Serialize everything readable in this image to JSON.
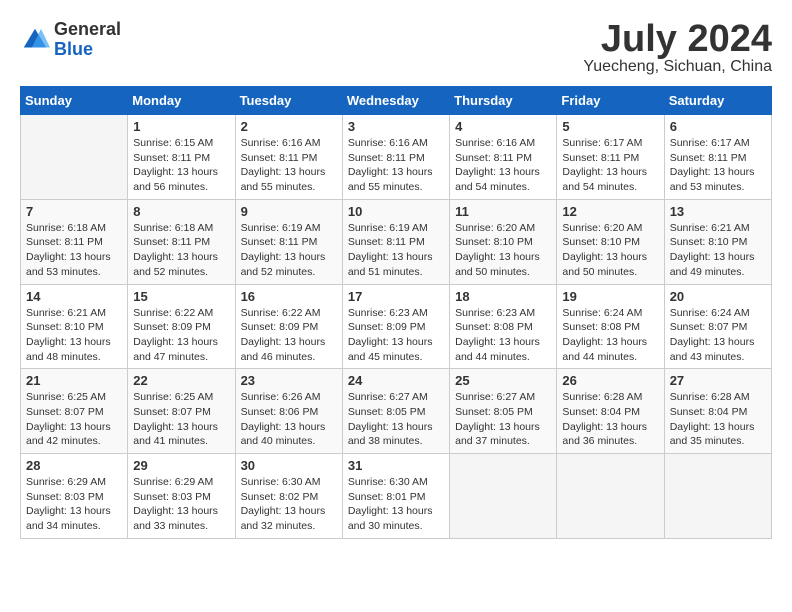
{
  "header": {
    "logo_general": "General",
    "logo_blue": "Blue",
    "month_year": "July 2024",
    "location": "Yuecheng, Sichuan, China"
  },
  "days_of_week": [
    "Sunday",
    "Monday",
    "Tuesday",
    "Wednesday",
    "Thursday",
    "Friday",
    "Saturday"
  ],
  "weeks": [
    [
      {
        "day": "",
        "empty": true
      },
      {
        "day": "1",
        "sunrise": "6:15 AM",
        "sunset": "8:11 PM",
        "daylight": "13 hours and 56 minutes."
      },
      {
        "day": "2",
        "sunrise": "6:16 AM",
        "sunset": "8:11 PM",
        "daylight": "13 hours and 55 minutes."
      },
      {
        "day": "3",
        "sunrise": "6:16 AM",
        "sunset": "8:11 PM",
        "daylight": "13 hours and 55 minutes."
      },
      {
        "day": "4",
        "sunrise": "6:16 AM",
        "sunset": "8:11 PM",
        "daylight": "13 hours and 54 minutes."
      },
      {
        "day": "5",
        "sunrise": "6:17 AM",
        "sunset": "8:11 PM",
        "daylight": "13 hours and 54 minutes."
      },
      {
        "day": "6",
        "sunrise": "6:17 AM",
        "sunset": "8:11 PM",
        "daylight": "13 hours and 53 minutes."
      }
    ],
    [
      {
        "day": "7",
        "sunrise": "6:18 AM",
        "sunset": "8:11 PM",
        "daylight": "13 hours and 53 minutes."
      },
      {
        "day": "8",
        "sunrise": "6:18 AM",
        "sunset": "8:11 PM",
        "daylight": "13 hours and 52 minutes."
      },
      {
        "day": "9",
        "sunrise": "6:19 AM",
        "sunset": "8:11 PM",
        "daylight": "13 hours and 52 minutes."
      },
      {
        "day": "10",
        "sunrise": "6:19 AM",
        "sunset": "8:11 PM",
        "daylight": "13 hours and 51 minutes."
      },
      {
        "day": "11",
        "sunrise": "6:20 AM",
        "sunset": "8:10 PM",
        "daylight": "13 hours and 50 minutes."
      },
      {
        "day": "12",
        "sunrise": "6:20 AM",
        "sunset": "8:10 PM",
        "daylight": "13 hours and 50 minutes."
      },
      {
        "day": "13",
        "sunrise": "6:21 AM",
        "sunset": "8:10 PM",
        "daylight": "13 hours and 49 minutes."
      }
    ],
    [
      {
        "day": "14",
        "sunrise": "6:21 AM",
        "sunset": "8:10 PM",
        "daylight": "13 hours and 48 minutes."
      },
      {
        "day": "15",
        "sunrise": "6:22 AM",
        "sunset": "8:09 PM",
        "daylight": "13 hours and 47 minutes."
      },
      {
        "day": "16",
        "sunrise": "6:22 AM",
        "sunset": "8:09 PM",
        "daylight": "13 hours and 46 minutes."
      },
      {
        "day": "17",
        "sunrise": "6:23 AM",
        "sunset": "8:09 PM",
        "daylight": "13 hours and 45 minutes."
      },
      {
        "day": "18",
        "sunrise": "6:23 AM",
        "sunset": "8:08 PM",
        "daylight": "13 hours and 44 minutes."
      },
      {
        "day": "19",
        "sunrise": "6:24 AM",
        "sunset": "8:08 PM",
        "daylight": "13 hours and 44 minutes."
      },
      {
        "day": "20",
        "sunrise": "6:24 AM",
        "sunset": "8:07 PM",
        "daylight": "13 hours and 43 minutes."
      }
    ],
    [
      {
        "day": "21",
        "sunrise": "6:25 AM",
        "sunset": "8:07 PM",
        "daylight": "13 hours and 42 minutes."
      },
      {
        "day": "22",
        "sunrise": "6:25 AM",
        "sunset": "8:07 PM",
        "daylight": "13 hours and 41 minutes."
      },
      {
        "day": "23",
        "sunrise": "6:26 AM",
        "sunset": "8:06 PM",
        "daylight": "13 hours and 40 minutes."
      },
      {
        "day": "24",
        "sunrise": "6:27 AM",
        "sunset": "8:05 PM",
        "daylight": "13 hours and 38 minutes."
      },
      {
        "day": "25",
        "sunrise": "6:27 AM",
        "sunset": "8:05 PM",
        "daylight": "13 hours and 37 minutes."
      },
      {
        "day": "26",
        "sunrise": "6:28 AM",
        "sunset": "8:04 PM",
        "daylight": "13 hours and 36 minutes."
      },
      {
        "day": "27",
        "sunrise": "6:28 AM",
        "sunset": "8:04 PM",
        "daylight": "13 hours and 35 minutes."
      }
    ],
    [
      {
        "day": "28",
        "sunrise": "6:29 AM",
        "sunset": "8:03 PM",
        "daylight": "13 hours and 34 minutes."
      },
      {
        "day": "29",
        "sunrise": "6:29 AM",
        "sunset": "8:03 PM",
        "daylight": "13 hours and 33 minutes."
      },
      {
        "day": "30",
        "sunrise": "6:30 AM",
        "sunset": "8:02 PM",
        "daylight": "13 hours and 32 minutes."
      },
      {
        "day": "31",
        "sunrise": "6:30 AM",
        "sunset": "8:01 PM",
        "daylight": "13 hours and 30 minutes."
      },
      {
        "day": "",
        "empty": true
      },
      {
        "day": "",
        "empty": true
      },
      {
        "day": "",
        "empty": true
      }
    ]
  ],
  "labels": {
    "sunrise": "Sunrise:",
    "sunset": "Sunset:",
    "daylight": "Daylight:"
  }
}
